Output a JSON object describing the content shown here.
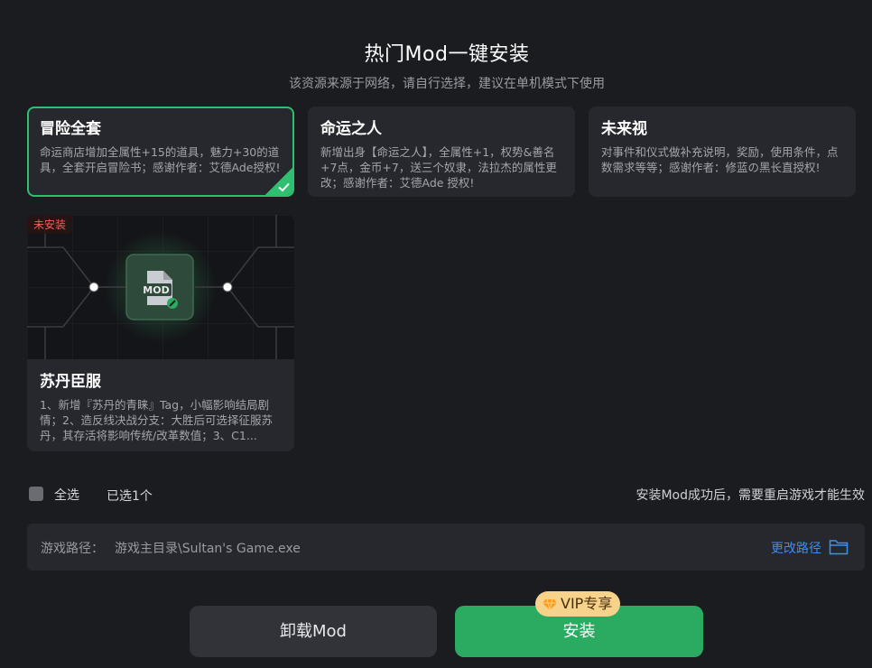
{
  "header": {
    "title": "热门Mod一键安装",
    "subtitle": "该资源来源于网络，请自行选择，建议在单机模式下使用"
  },
  "mods": [
    {
      "title": "冒险全套",
      "desc": "命运商店增加全属性+15的道具，魅力+30的道具，全套开启冒险书；感谢作者：艾德Ade授权!",
      "selected": true
    },
    {
      "title": "命运之人",
      "desc": "新增出身【命运之人】，全属性+1，权势&善名+7点，金币+7，送三个奴隶，法拉杰的属性更改；感谢作者：艾德Ade 授权!",
      "selected": false
    },
    {
      "title": "未来视",
      "desc": "对事件和仪式做补充说明，奖励，使用条件，点数需求等等；感谢作者：修蓝の黑长直授权!",
      "selected": false
    },
    {
      "title": "苏丹臣服",
      "desc": "1、新增『苏丹的青睐』Tag，小幅影响结局剧情；2、造反线决战分支：大胜后可选择征服苏丹，其存活将影响传统/改革数值；3、C1...",
      "badge": "未安装",
      "thumb_text": "MOD",
      "selected": false
    }
  ],
  "footer": {
    "select_all": "全选",
    "selected_count": "已选1个",
    "restart_note": "安装Mod成功后，需要重启游戏才能生效"
  },
  "path": {
    "label": "游戏路径：",
    "value": "游戏主目录\\Sultan's Game.exe",
    "change_label": "更改路径"
  },
  "buttons": {
    "uninstall": "卸载Mod",
    "install": "安装",
    "vip_badge": "VIP专享"
  },
  "colors": {
    "accent_green": "#2bab61",
    "link_blue": "#3d8ef0",
    "vip_gold": "#f6d28b",
    "warning_red": "#ff5a5a"
  },
  "icons": [
    "check-icon",
    "mod-file-icon",
    "folder-icon",
    "gem-icon"
  ]
}
